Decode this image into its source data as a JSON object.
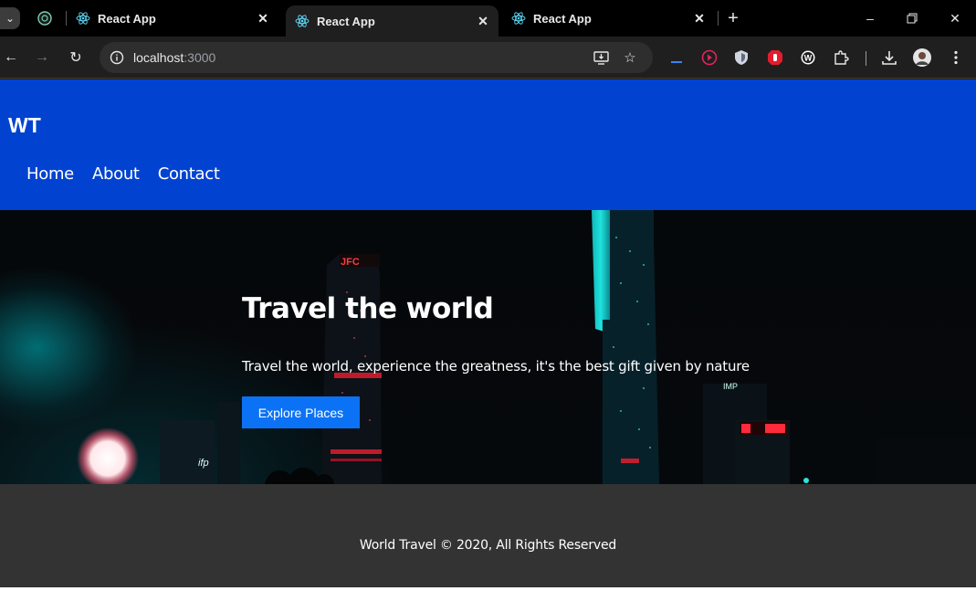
{
  "browser": {
    "tabs": [
      {
        "title": "React App",
        "active": false
      },
      {
        "title": "React App",
        "active": true
      },
      {
        "title": "React App",
        "active": false
      }
    ],
    "address": {
      "host": "localhost",
      "port": ":3000"
    },
    "icons": [
      "tab-search-icon",
      "chatgpt-icon",
      "react-icon",
      "close-icon",
      "new-tab-icon",
      "minimize-icon",
      "restore-icon",
      "window-close-icon",
      "back-icon",
      "forward-icon",
      "reload-icon",
      "site-info-icon",
      "install-app-icon",
      "bookmark-star-icon",
      "download-icon",
      "profile-avatar",
      "menu-icon"
    ]
  },
  "site": {
    "logo": "WT",
    "nav": [
      "Home",
      "About",
      "Contact"
    ],
    "hero": {
      "title": "Travel the world",
      "subtitle": "Travel the world, experience the greatness, it's the best gift given by nature",
      "button": "Explore Places"
    },
    "footer": "World Travel © 2020, All Rights Reserved"
  },
  "colors": {
    "header_bg": "#0143d0",
    "button_bg": "#0c72f5",
    "footer_bg": "#333333",
    "browser_bg": "#1f1f1f"
  }
}
